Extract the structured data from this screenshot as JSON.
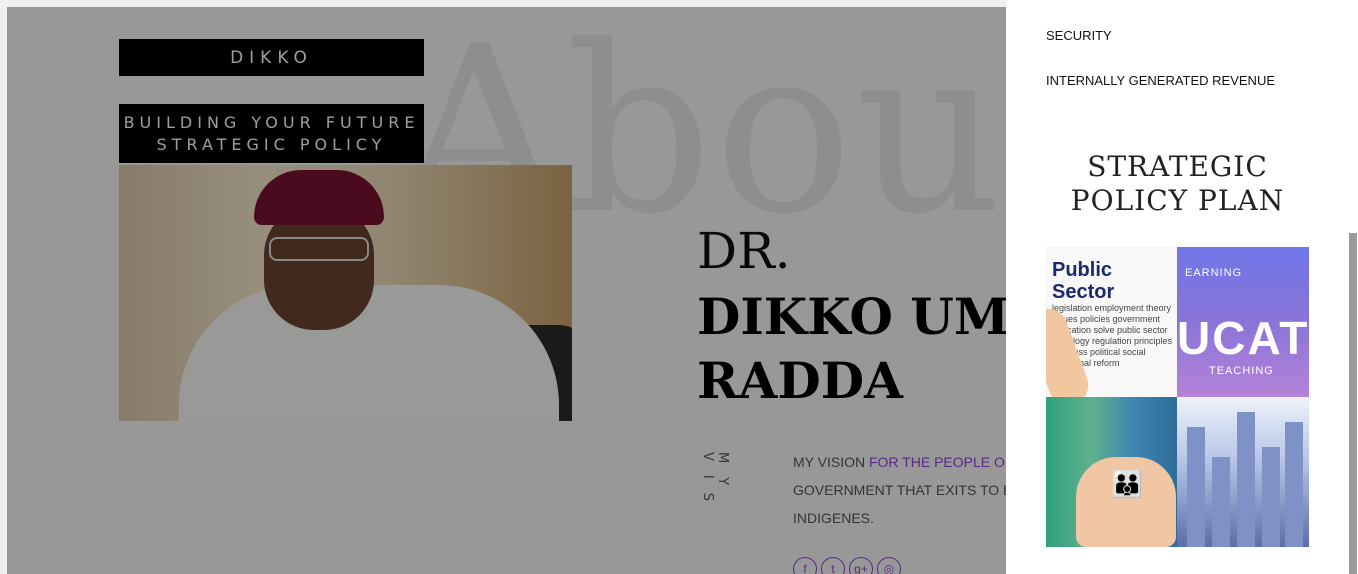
{
  "header": {
    "brand": "DIKKO",
    "tagline_line1": "BUILDING YOUR FUTURE",
    "tagline_line2": "STRATEGIC POLICY"
  },
  "about": {
    "watermark": "About",
    "title_small": "DR.",
    "name_line1": "DIKKO UMMA",
    "name_line2": "RADDA",
    "side_label": "MY VIS",
    "vision_prefix": "MY VISION ",
    "vision_highlight": "FOR THE PEOPLE OF",
    "vision_line2": "GOVERNMENT THAT EXITS TO B",
    "vision_line3": "INDIGENES."
  },
  "social": [
    "f",
    "t",
    "g+",
    "◎"
  ],
  "panel": {
    "menu_items": [
      "SECURITY",
      "INTERNALLY GENERATED REVENUE"
    ],
    "section_title_line1": "STRATEGIC",
    "section_title_line2": "POLICY PLAN",
    "tiles": [
      {
        "name": "public-sector",
        "caption": "Public Sector"
      },
      {
        "name": "education",
        "caption_top": "EARNING",
        "caption_big": "UCAT",
        "caption_bottom": "TEACHING"
      },
      {
        "name": "family-hands",
        "caption": ""
      },
      {
        "name": "city-business",
        "caption": ""
      }
    ],
    "public_sector_words": "legislation employment theory issues policies government education solve public sector sociology regulation principles business political social traditional reform"
  },
  "colors": {
    "accent": "#8a46d8",
    "panel_bg": "#ffffff",
    "overlay": "rgba(0,0,0,0.38)"
  }
}
